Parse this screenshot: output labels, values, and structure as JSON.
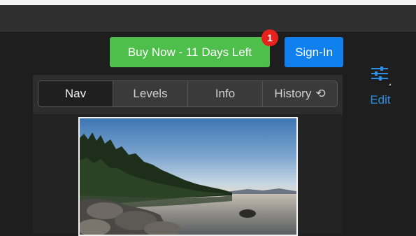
{
  "header": {
    "buy_label": "Buy Now - 11 Days Left",
    "notification_count": "1",
    "signin_label": "Sign-In"
  },
  "navigator": {
    "tabs": [
      {
        "label": "Nav",
        "active": true
      },
      {
        "label": "Levels",
        "active": false
      },
      {
        "label": "Info",
        "active": false
      },
      {
        "label": "History",
        "active": false,
        "icon": "undo-icon"
      }
    ]
  },
  "side": {
    "edit_label": "Edit",
    "edit_icon": "sliders-icon",
    "accent": "#2e8fe6"
  },
  "colors": {
    "buy": "#4dbf4a",
    "signin": "#1180ef",
    "badge": "#e8211d"
  }
}
